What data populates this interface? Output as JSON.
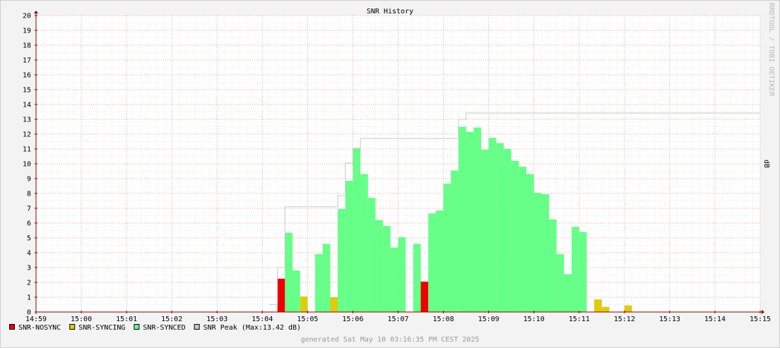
{
  "chart_data": {
    "type": "bar",
    "title": "SNR History",
    "ylabel": "dB",
    "watermark": "RRDTOOL / TOBI OETIKER",
    "ylim": [
      0,
      20
    ],
    "yticks": [
      "0",
      "1",
      "2",
      "3",
      "4",
      "5",
      "6",
      "7",
      "8",
      "9",
      "10",
      "11",
      "12",
      "13",
      "14",
      "15",
      "16",
      "17",
      "18",
      "19",
      "20"
    ],
    "xlim": [
      "14:59",
      "15:15"
    ],
    "xticks": [
      "14:59",
      "15:00",
      "15:01",
      "15:02",
      "15:03",
      "15:04",
      "15:05",
      "15:06",
      "15:07",
      "15:08",
      "15:09",
      "15:10",
      "15:11",
      "15:12",
      "15:13",
      "15:14",
      "15:15"
    ],
    "grid": true,
    "legend_placement": "bottom-left",
    "colors": {
      "nosync": "#ee0000",
      "syncing": "#ddcc11",
      "synced": "#66ff88",
      "peak": "#c8c8c8",
      "grid_major": "#f0a0a0",
      "grid_minor": "#e8e8e8",
      "axis": "#900000"
    },
    "x_step_seconds": 10,
    "series": [
      {
        "name": "SNR-NOSYNC",
        "kind": "bar",
        "points": [
          {
            "time": "15:04:20",
            "value": 2.25
          },
          {
            "time": "15:07:30",
            "value": 2.05
          }
        ]
      },
      {
        "name": "SNR-SYNCING",
        "kind": "bar",
        "points": [
          {
            "time": "15:04:50",
            "value": 1.05
          },
          {
            "time": "15:05:30",
            "value": 1.0
          },
          {
            "time": "15:11:20",
            "value": 0.85
          },
          {
            "time": "15:11:30",
            "value": 0.35
          },
          {
            "time": "15:12:00",
            "value": 0.45
          }
        ]
      },
      {
        "name": "SNR-SYNCED",
        "kind": "bar",
        "points": [
          {
            "time": "15:04:30",
            "value": 5.35
          },
          {
            "time": "15:04:40",
            "value": 2.8
          },
          {
            "time": "15:05:10",
            "value": 3.9
          },
          {
            "time": "15:05:20",
            "value": 4.6
          },
          {
            "time": "15:05:40",
            "value": 6.95
          },
          {
            "time": "15:05:50",
            "value": 8.85
          },
          {
            "time": "15:06:00",
            "value": 11.05
          },
          {
            "time": "15:06:10",
            "value": 9.3
          },
          {
            "time": "15:06:20",
            "value": 7.7
          },
          {
            "time": "15:06:30",
            "value": 6.2
          },
          {
            "time": "15:06:40",
            "value": 5.8
          },
          {
            "time": "15:06:50",
            "value": 4.35
          },
          {
            "time": "15:07:00",
            "value": 5.05
          },
          {
            "time": "15:07:20",
            "value": 4.6
          },
          {
            "time": "15:07:40",
            "value": 6.65
          },
          {
            "time": "15:07:50",
            "value": 6.85
          },
          {
            "time": "15:08:00",
            "value": 8.65
          },
          {
            "time": "15:08:10",
            "value": 9.55
          },
          {
            "time": "15:08:20",
            "value": 12.5
          },
          {
            "time": "15:08:30",
            "value": 12.15
          },
          {
            "time": "15:08:40",
            "value": 12.45
          },
          {
            "time": "15:08:50",
            "value": 10.95
          },
          {
            "time": "15:09:00",
            "value": 11.75
          },
          {
            "time": "15:09:10",
            "value": 11.4
          },
          {
            "time": "15:09:20",
            "value": 11.0
          },
          {
            "time": "15:09:30",
            "value": 10.2
          },
          {
            "time": "15:09:40",
            "value": 9.8
          },
          {
            "time": "15:09:50",
            "value": 9.3
          },
          {
            "time": "15:10:00",
            "value": 8.05
          },
          {
            "time": "15:10:10",
            "value": 7.95
          },
          {
            "time": "15:10:20",
            "value": 6.25
          },
          {
            "time": "15:10:30",
            "value": 3.9
          },
          {
            "time": "15:10:40",
            "value": 2.55
          },
          {
            "time": "15:10:50",
            "value": 5.75
          },
          {
            "time": "15:11:00",
            "value": 5.4
          }
        ]
      },
      {
        "name": "SNR Peak",
        "kind": "line",
        "points": [
          {
            "time": "15:04:10",
            "value": 0.5
          },
          {
            "time": "15:04:20",
            "value": 3.0
          },
          {
            "time": "15:04:30",
            "value": 7.1
          },
          {
            "time": "15:05:40",
            "value": 7.85
          },
          {
            "time": "15:05:50",
            "value": 10.05
          },
          {
            "time": "15:06:00",
            "value": 11.05
          },
          {
            "time": "15:06:10",
            "value": 11.7
          },
          {
            "time": "15:08:20",
            "value": 13.0
          },
          {
            "time": "15:08:30",
            "value": 13.42
          },
          {
            "time": "15:15:00",
            "value": 13.42
          }
        ]
      }
    ],
    "legend": [
      {
        "label": "SNR-NOSYNC",
        "color": "#ee0000"
      },
      {
        "label": "SNR-SYNCING",
        "color": "#ddcc11"
      },
      {
        "label": "SNR-SYNCED",
        "color": "#66ff88"
      },
      {
        "label": "SNR Peak  (Max:13.42 dB)",
        "color": "#c8c8c8"
      }
    ],
    "footer": "generated Sat May 10 03:16:35 PM CEST 2025"
  }
}
